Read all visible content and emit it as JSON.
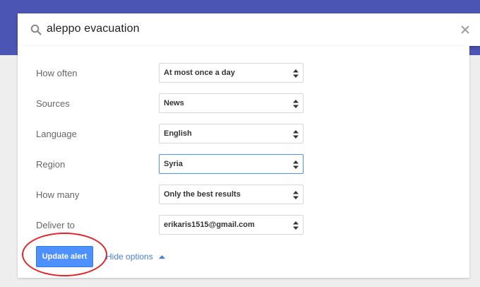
{
  "search": {
    "query": "aleppo evacuation",
    "icon": "search-icon",
    "clear_icon": "close-icon"
  },
  "options": [
    {
      "label": "How often",
      "value": "At most once a day"
    },
    {
      "label": "Sources",
      "value": "News"
    },
    {
      "label": "Language",
      "value": "English"
    },
    {
      "label": "Region",
      "value": "Syria"
    },
    {
      "label": "How many",
      "value": "Only the best results"
    },
    {
      "label": "Deliver to",
      "value": "erikaris1515@gmail.com"
    }
  ],
  "actions": {
    "update_label": "Update alert",
    "hide_options_label": "Hide options"
  },
  "colors": {
    "header": "#4b55b4",
    "primary_button": "#4d90fe",
    "link": "#4a7fd4",
    "annotation_circle": "#e0242b"
  }
}
